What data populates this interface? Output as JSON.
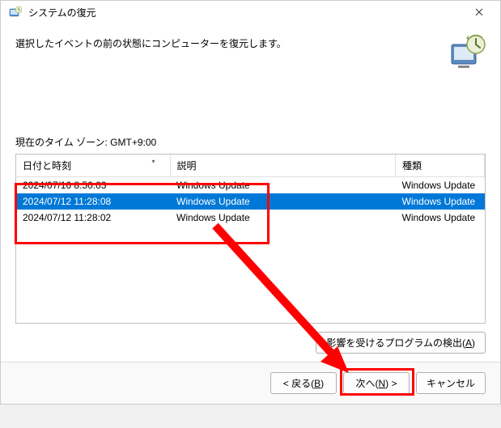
{
  "window": {
    "title": "システムの復元"
  },
  "subtitle": "選択したイベントの前の状態にコンピューターを復元します。",
  "timezone_label": "現在のタイム ゾーン: GMT+9:00",
  "table": {
    "headers": {
      "datetime": "日付と時刻",
      "description": "説明",
      "type": "種類"
    },
    "rows": [
      {
        "datetime": "2024/07/16 8:50:03",
        "description": "Windows Update",
        "type": "Windows Update",
        "selected": false
      },
      {
        "datetime": "2024/07/12 11:28:08",
        "description": "Windows Update",
        "type": "Windows Update",
        "selected": true
      },
      {
        "datetime": "2024/07/12 11:28:02",
        "description": "Windows Update",
        "type": "Windows Update",
        "selected": false
      }
    ]
  },
  "buttons": {
    "scan_affected": "影響を受けるプログラムの検出",
    "scan_affected_key": "A",
    "back": "< 戻る",
    "back_key": "B",
    "next": "次へ",
    "next_key": "N",
    "next_suffix": " >",
    "cancel": "キャンセル"
  }
}
